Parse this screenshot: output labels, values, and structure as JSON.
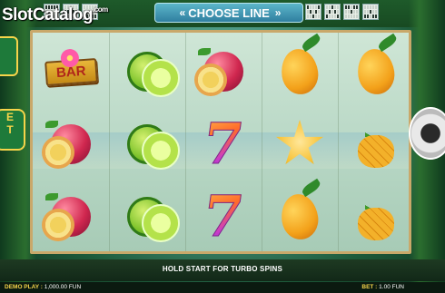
{
  "watermark": {
    "text": "SlotCatalog",
    "suffix": ".com"
  },
  "header": {
    "choose_line_label": "CHOOSE LINE",
    "left_arrows": "«",
    "right_arrows": "»"
  },
  "paylines_left": [
    [
      1,
      1,
      1,
      1,
      1,
      0,
      0,
      0,
      0,
      0,
      0,
      0,
      0,
      0,
      0
    ],
    [
      0,
      0,
      0,
      0,
      0,
      1,
      1,
      1,
      1,
      1,
      0,
      0,
      0,
      0,
      0
    ],
    [
      0,
      0,
      0,
      0,
      0,
      0,
      0,
      0,
      0,
      0,
      1,
      1,
      1,
      1,
      1
    ]
  ],
  "paylines_right": [
    [
      1,
      0,
      0,
      0,
      1,
      0,
      1,
      0,
      1,
      0,
      0,
      0,
      1,
      0,
      0
    ],
    [
      0,
      0,
      1,
      0,
      0,
      0,
      1,
      0,
      1,
      0,
      1,
      0,
      0,
      0,
      1
    ],
    [
      1,
      1,
      0,
      1,
      1,
      0,
      0,
      1,
      0,
      0,
      0,
      0,
      0,
      0,
      0
    ],
    [
      0,
      0,
      0,
      0,
      0,
      0,
      0,
      1,
      0,
      0,
      1,
      1,
      0,
      1,
      1
    ]
  ],
  "reels": [
    [
      "bar",
      "passion",
      "passion"
    ],
    [
      "lime",
      "lime",
      "lime"
    ],
    [
      "passion",
      "seven",
      "seven"
    ],
    [
      "mango",
      "star",
      "mango"
    ],
    [
      "mango",
      "pineapple",
      "pineapple"
    ]
  ],
  "symbols": {
    "bar_label": "BAR",
    "seven_label": "7"
  },
  "side": {
    "left_badge_text": "E\nT"
  },
  "hold_message": "HOLD START FOR TURBO SPINS",
  "footer": {
    "demo_label": "DEMO PLAY :",
    "demo_value": "1,000.00 FUN",
    "bet_label": "BET :",
    "bet_value": "1.00 FUN"
  },
  "colors": {
    "accent": "#f6d44a",
    "frame": "#c9a86a",
    "choose_line_bg": "#3f8fb0"
  }
}
